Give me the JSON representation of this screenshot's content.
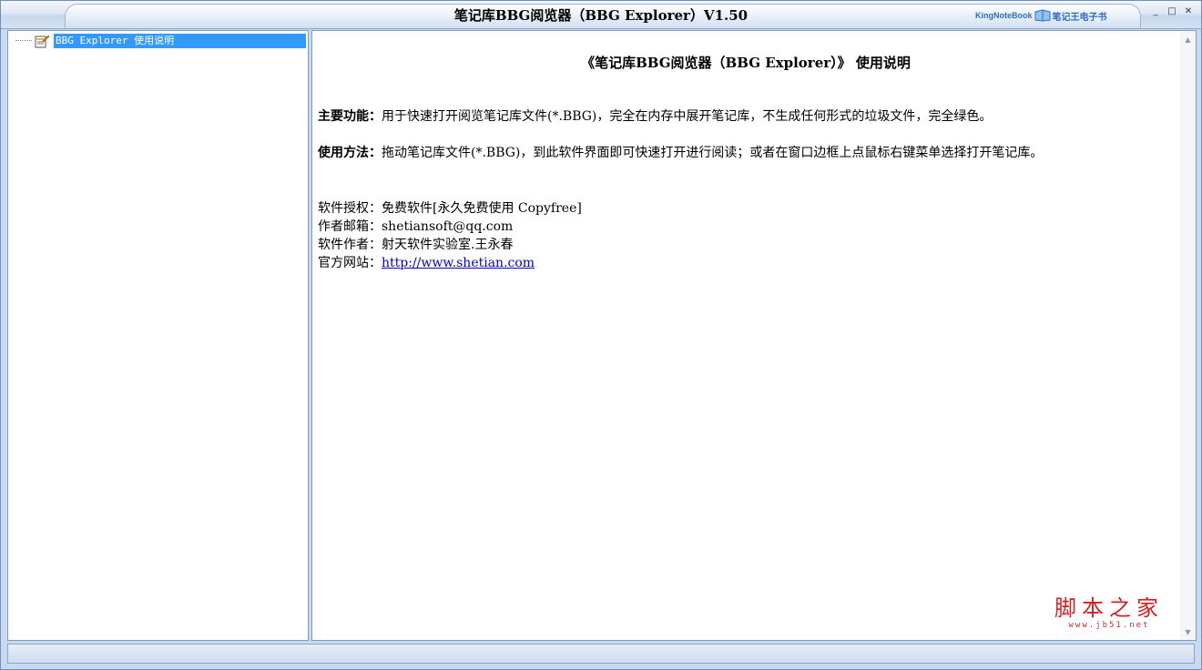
{
  "window": {
    "title": "笔记库BBG阅览器（BBG Explorer）V1.50",
    "brand_en": "KingNoteBook",
    "brand_cn": "笔记王电子书",
    "minimize": "_",
    "maximize": "□",
    "close": "✕"
  },
  "tree": {
    "items": [
      {
        "label": "BBG Explorer 使用说明",
        "selected": true
      }
    ]
  },
  "doc": {
    "title": "《笔记库BBG阅览器（BBG Explorer）》 使用说明",
    "features_label": "主要功能：",
    "features_text": "用于快速打开阅览笔记库文件(*.BBG)，完全在内存中展开笔记库，不生成任何形式的垃圾文件，完全绿色。",
    "usage_label": "使用方法：",
    "usage_text": "拖动笔记库文件(*.BBG)，到此软件界面即可快速打开进行阅读；或者在窗口边框上点鼠标右键菜单选择打开笔记库。",
    "license_label": "软件授权：",
    "license_text": "免费软件[永久免费使用 Copyfree]",
    "email_label": "作者邮箱：",
    "email_text": "shetiansoft@qq.com",
    "author_label": "软件作者：",
    "author_text": "射天软件实验室.王永春",
    "site_label": "官方网站：",
    "site_text": "http://www.shetian.com"
  },
  "watermark": {
    "cn": "脚本之家",
    "url": "www.jb51.net"
  },
  "colors": {
    "selection": "#3399ff",
    "link": "#0000cc",
    "watermark": "#d42020",
    "frame": "#c9d9ef"
  }
}
